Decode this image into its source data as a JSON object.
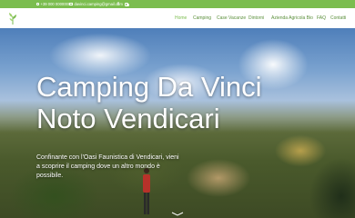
{
  "topbar": {
    "phone": "+39 000 0000000",
    "email": "davinci.camping@gmail.com",
    "social_icons": [
      "facebook-icon",
      "instagram-icon"
    ]
  },
  "nav": {
    "items": [
      {
        "label": "Home",
        "active": true
      },
      {
        "label": "Camping"
      },
      {
        "label": "Case Vacanze"
      },
      {
        "label": "Dintorni"
      },
      {
        "label": "Azienda Agricola Bio"
      },
      {
        "label": "FAQ"
      },
      {
        "label": "Contatti"
      }
    ]
  },
  "hero": {
    "title_line1": "Camping Da Vinci",
    "title_line2": "Noto Vendicari",
    "subtitle": "Confinante con l'Oasi Faunistica di Vendicari, vieni a scoprire il camping dove un altro mondo è possibile."
  },
  "colors": {
    "brand_green": "#7bbd4f",
    "nav_text": "#5a8f3a",
    "hero_text": "#ffffff"
  }
}
